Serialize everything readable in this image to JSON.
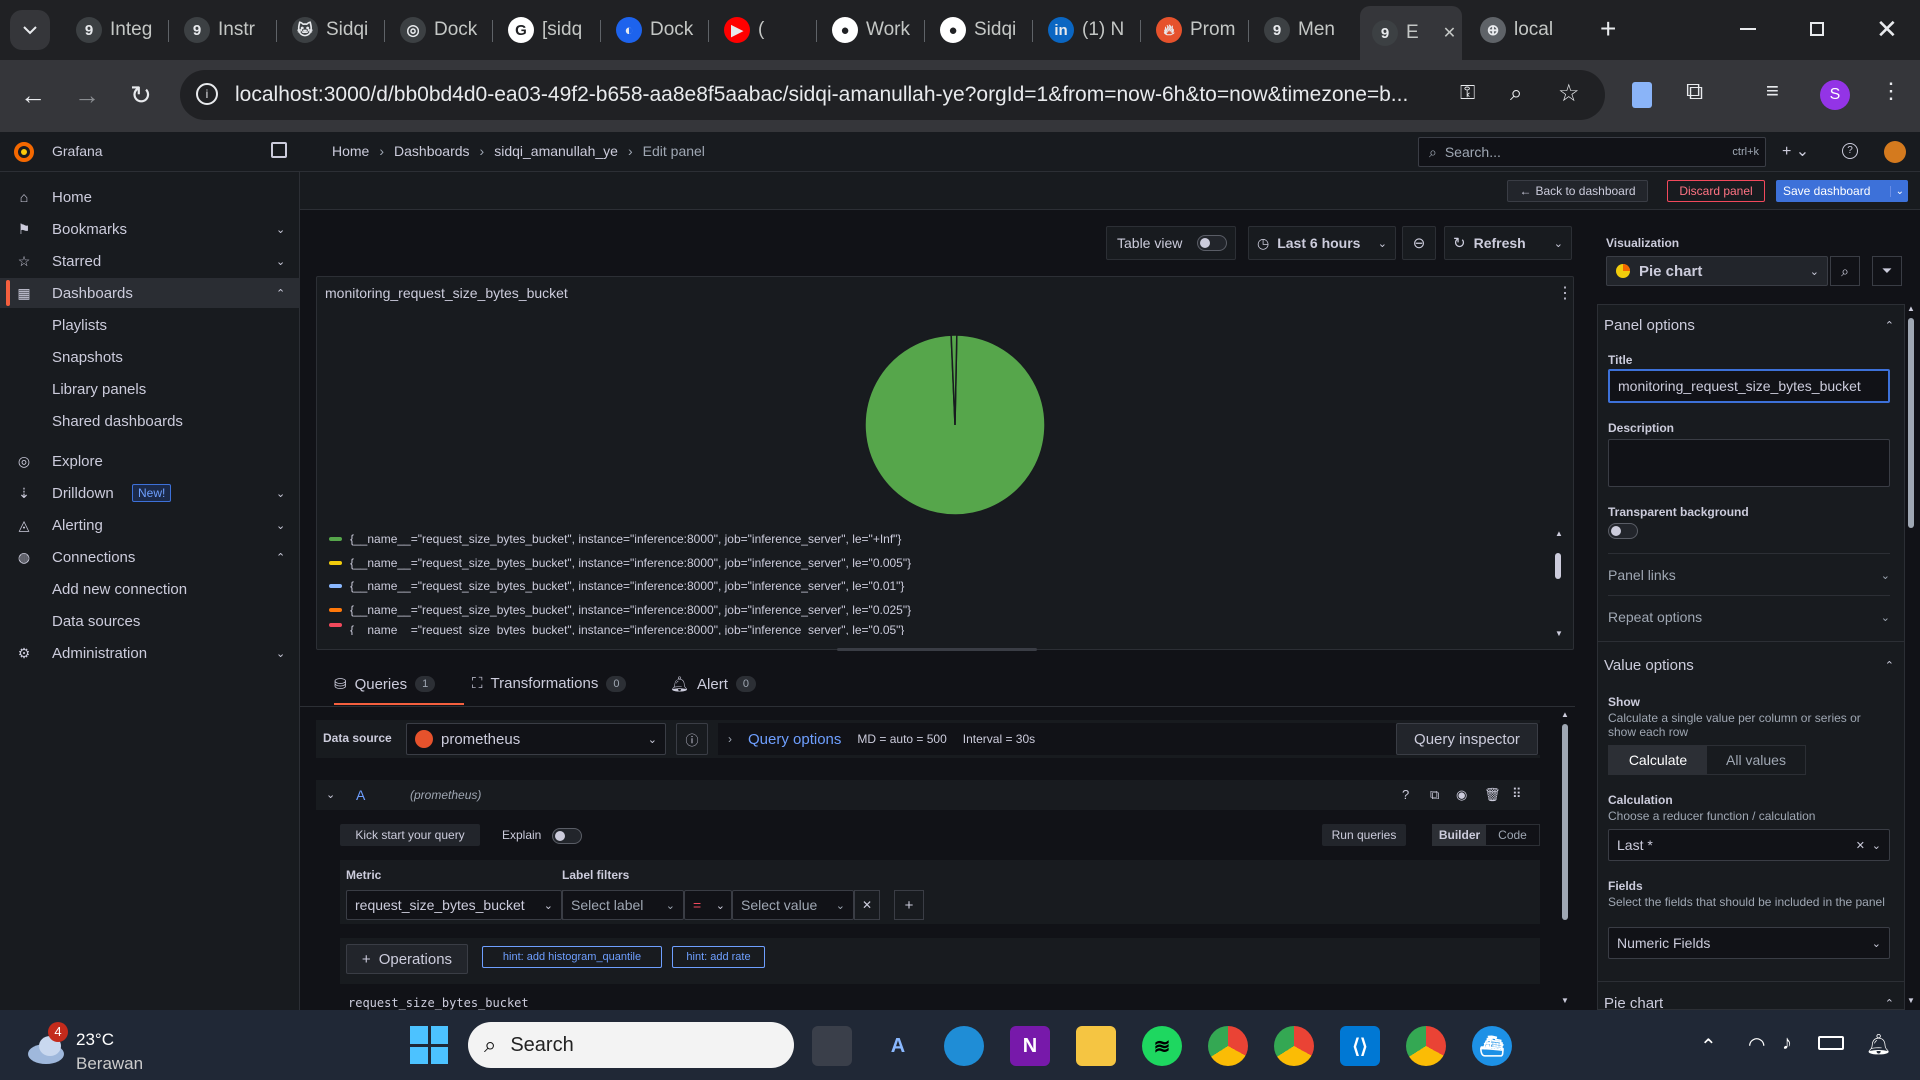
{
  "browser": {
    "tabs": [
      {
        "label": "Integ",
        "icon": "grafana-icon"
      },
      {
        "label": "Instr",
        "icon": "grafana-icon"
      },
      {
        "label": "Sidqi",
        "icon": "cat-icon"
      },
      {
        "label": "Dock",
        "icon": "openai-icon"
      },
      {
        "label": "[sidq",
        "icon": "google-icon"
      },
      {
        "label": "Dock",
        "icon": "docker-icon"
      },
      {
        "label": "(",
        "icon": "youtube-icon"
      },
      {
        "label": "Work",
        "icon": "github-icon"
      },
      {
        "label": "Sidqi",
        "icon": "github-icon"
      },
      {
        "label": "(1) N",
        "icon": "linkedin-icon"
      },
      {
        "label": "Prom",
        "icon": "prometheus-icon"
      },
      {
        "label": "Men",
        "icon": "grafana-icon"
      },
      {
        "label": "E",
        "icon": "grafana-icon",
        "active": true
      },
      {
        "label": "local",
        "icon": "globe-icon"
      }
    ],
    "url": "localhost:3000/d/bb0bd4d0-ea03-49f2-b658-aa8e8f5aabac/sidqi-amanullah-ye?orgId=1&from=now-6h&to=now&timezone=b...",
    "profile_initial": "S"
  },
  "grafana": {
    "app_name": "Grafana",
    "breadcrumb": [
      "Home",
      "Dashboards",
      "sidqi_amanullah_ye",
      "Edit panel"
    ],
    "search_placeholder": "Search...",
    "search_shortcut": "ctrl+k",
    "nav": [
      {
        "label": "Home",
        "icon": "home-icon"
      },
      {
        "label": "Bookmarks",
        "icon": "bookmark-icon",
        "chevron": "down"
      },
      {
        "label": "Starred",
        "icon": "star-icon",
        "chevron": "down"
      },
      {
        "label": "Dashboards",
        "icon": "apps-icon",
        "chevron": "up",
        "active": true
      },
      {
        "label": "Playlists",
        "sub": true
      },
      {
        "label": "Snapshots",
        "sub": true
      },
      {
        "label": "Library panels",
        "sub": true
      },
      {
        "label": "Shared dashboards",
        "sub": true
      },
      {
        "label": "Explore",
        "icon": "compass-icon"
      },
      {
        "label": "Drilldown",
        "icon": "drilldown-icon",
        "chevron": "down",
        "badge": "New!"
      },
      {
        "label": "Alerting",
        "icon": "bell-icon",
        "chevron": "down"
      },
      {
        "label": "Connections",
        "icon": "connections-icon",
        "chevron": "up"
      },
      {
        "label": "Add new connection",
        "sub": true
      },
      {
        "label": "Data sources",
        "sub": true
      },
      {
        "label": "Administration",
        "icon": "cog-icon",
        "chevron": "down"
      }
    ],
    "actions": {
      "back": "Back to dashboard",
      "discard": "Discard panel",
      "save": "Save dashboard"
    },
    "toolbar": {
      "table_view": "Table view",
      "time_range": "Last 6 hours",
      "refresh": "Refresh"
    },
    "panel": {
      "title": "monitoring_request_size_bytes_bucket",
      "legend": [
        {
          "label": "{__name__=\"request_size_bytes_bucket\", instance=\"inference:8000\", job=\"inference_server\", le=\"+Inf\"}",
          "color": "#56a64b"
        },
        {
          "label": "{__name__=\"request_size_bytes_bucket\", instance=\"inference:8000\", job=\"inference_server\", le=\"0.005\"}",
          "color": "#f2cc0c"
        },
        {
          "label": "{__name__=\"request_size_bytes_bucket\", instance=\"inference:8000\", job=\"inference_server\", le=\"0.01\"}",
          "color": "#8ab8ff"
        },
        {
          "label": "{__name__=\"request_size_bytes_bucket\", instance=\"inference:8000\", job=\"inference_server\", le=\"0.025\"}",
          "color": "#ff780a"
        },
        {
          "label": "{__name__=\"request_size_bytes_bucket\", instance=\"inference:8000\", job=\"inference_server\", le=\"0.05\"}",
          "color": "#f2495c"
        }
      ]
    },
    "query_tabs": [
      {
        "label": "Queries",
        "count": "1",
        "icon": "database-icon"
      },
      {
        "label": "Transformations",
        "count": "0",
        "icon": "transform-icon"
      },
      {
        "label": "Alert",
        "count": "0",
        "icon": "bell-icon"
      }
    ],
    "query": {
      "data_source_label": "Data source",
      "data_source": "prometheus",
      "query_options": "Query options",
      "md": "MD = auto = 500",
      "interval": "Interval = 30s",
      "inspector": "Query inspector",
      "ref_id": "A",
      "ref_source": "(prometheus)",
      "kick_start": "Kick start your query",
      "explain": "Explain",
      "run": "Run queries",
      "builder": "Builder",
      "code": "Code",
      "metric_label": "Metric",
      "metric": "request_size_bytes_bucket",
      "label_filters": "Label filters",
      "select_label": "Select label",
      "operator": "=",
      "select_value": "Select value",
      "operations": "Operations",
      "hint1": "hint: add histogram_quantile",
      "hint2": "hint: add rate",
      "preview": "request_size_bytes_bucket"
    },
    "options": {
      "visualization_label": "Visualization",
      "visualization": "Pie chart",
      "panel_options": "Panel options",
      "title_label": "Title",
      "title_value": "monitoring_request_size_bytes_bucket",
      "description_label": "Description",
      "transparent_label": "Transparent background",
      "panel_links": "Panel links",
      "repeat_options": "Repeat options",
      "value_options": "Value options",
      "show_label": "Show",
      "show_desc": "Calculate a single value per column or series or show each row",
      "calculate": "Calculate",
      "all_values": "All values",
      "calculation_label": "Calculation",
      "calculation_desc": "Choose a reducer function / calculation",
      "calculation_value": "Last *",
      "fields_label": "Fields",
      "fields_desc": "Select the fields that should be included in the panel",
      "fields_value": "Numeric Fields",
      "pie_chart_section": "Pie chart"
    }
  },
  "chart_data": {
    "type": "pie",
    "series": [
      {
        "name": "le=\"+Inf\"",
        "value": 99
      },
      {
        "name": "le=\"0.005\"",
        "value": 1
      }
    ],
    "colors": [
      "#56a64b",
      "#56a64b"
    ],
    "legend_placement": "bottom"
  },
  "taskbar": {
    "weather_temp": "23°C",
    "weather_desc": "Berawan",
    "weather_badge": "4",
    "search_placeholder": "Search"
  }
}
